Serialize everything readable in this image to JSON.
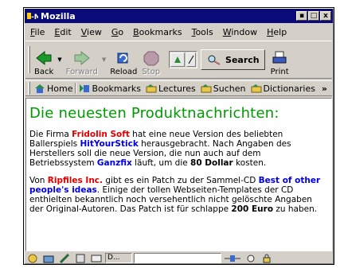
{
  "window": {
    "title": "Mozilla",
    "title_logo": "-M"
  },
  "titlebar": {
    "minimize": "▪",
    "maximize": "□",
    "close": "x"
  },
  "menu": [
    {
      "prefix": "",
      "ul": "F",
      "rest": "ile"
    },
    {
      "prefix": "",
      "ul": "E",
      "rest": "dit"
    },
    {
      "prefix": "",
      "ul": "V",
      "rest": "iew"
    },
    {
      "prefix": "",
      "ul": "G",
      "rest": "o"
    },
    {
      "prefix": "",
      "ul": "B",
      "rest": "ookmarks"
    },
    {
      "prefix": "",
      "ul": "T",
      "rest": "ools"
    },
    {
      "prefix": "",
      "ul": "W",
      "rest": "indow"
    },
    {
      "prefix": "",
      "ul": "H",
      "rest": "elp"
    }
  ],
  "nav": {
    "back": "Back",
    "forward": "Forward",
    "reload": "Reload",
    "stop": "Stop",
    "search": "Search",
    "print": "Print"
  },
  "personal": {
    "home": "Home",
    "bookmarks": "Bookmarks",
    "lectures": "Lectures",
    "suchen": "Suchen",
    "dictionaries": "Dictionaries",
    "more": "»"
  },
  "content": {
    "heading": "Die neuesten Produktnachrichten:",
    "p1": {
      "t1": "Die Firma ",
      "company1": "Fridolin Soft",
      "t2": " hat eine neue Version des beliebten Ballerspiels ",
      "game": "HitYourStick",
      "t3": " herausgebracht. Nach Angaben des Herstellers soll die neue Version, die nun auch auf dem Betriebssystem ",
      "os": "Ganzfix",
      "t4": " läuft, um die ",
      "price": "80 Dollar",
      "t5": " kosten."
    },
    "p2": {
      "t1": "Von ",
      "company2": "Ripfiles Inc.",
      "t2": " gibt es ein Patch zu der Sammel-CD ",
      "cd": "Best of other people's ideas",
      "t3": ". Einige der tollen Webseiten-Templates der CD enthielten bekanntlich noch versehentlich nicht gelöschte Angaben der Original-Autoren. Das Patch ist für schlappe ",
      "price": "200 Euro",
      "t4": " zu haben."
    }
  },
  "status": {
    "text": "D..."
  },
  "colors": {
    "titlebar": "#0a0a78",
    "heading": "#009a00",
    "red_link": "#e00000",
    "blue_link": "#0000e0",
    "chrome": "#d4d0c8"
  },
  "icons": [
    "mozilla-logo-icon",
    "back-arrow-icon",
    "forward-arrow-icon",
    "reload-icon",
    "stop-icon",
    "url-page-icon",
    "search-magnifier-icon",
    "print-icon",
    "home-icon",
    "bookmarks-icon",
    "folder-icon",
    "navigator-icon",
    "mail-icon",
    "composer-icon",
    "addressbook-icon",
    "irc-icon",
    "online-status-icon",
    "security-lock-icon"
  ]
}
